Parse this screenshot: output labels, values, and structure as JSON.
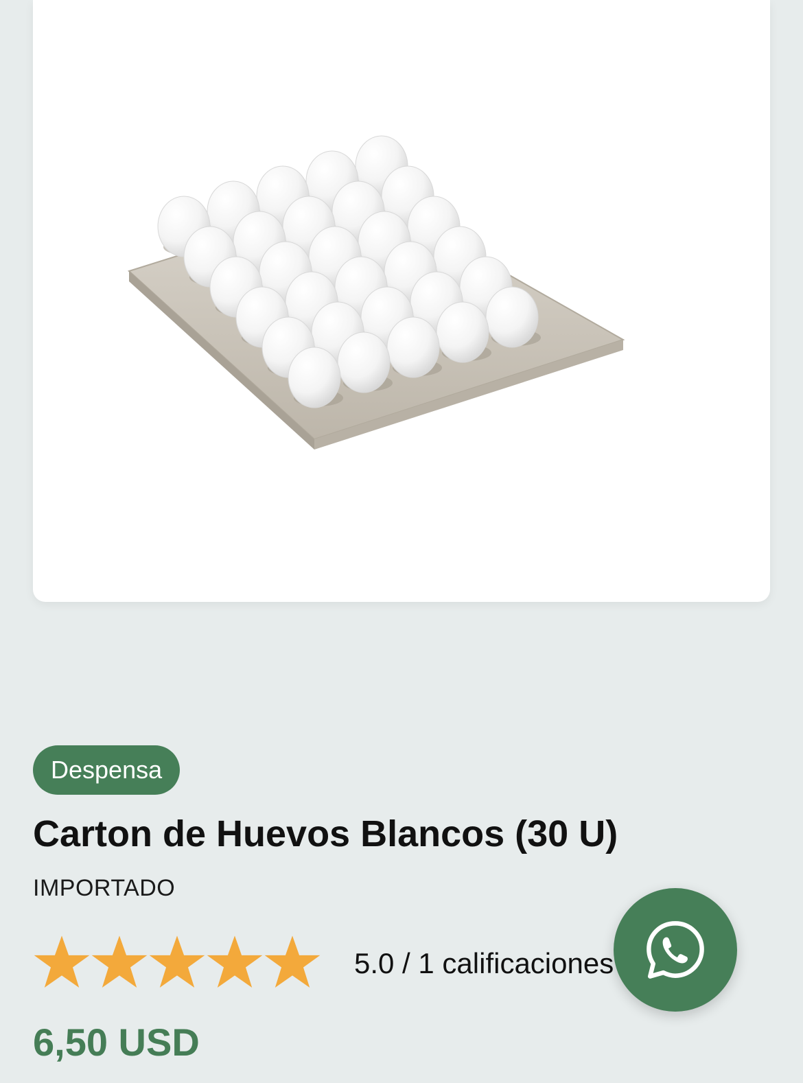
{
  "product": {
    "image_alt": "Carton de Huevos Blancos (30 U)",
    "category": "Despensa",
    "title": "Carton de Huevos Blancos (30 U)",
    "brand": "IMPORTADO",
    "rating": {
      "stars": 5,
      "max_stars": 5,
      "text": "5.0 / 1 calificaciones"
    },
    "price": "6,50 USD"
  },
  "colors": {
    "accent": "#467f58",
    "price": "#457d56",
    "star": "#f3a93b",
    "background": "#e7ecec"
  },
  "floating_button": {
    "icon": "whatsapp-icon"
  }
}
